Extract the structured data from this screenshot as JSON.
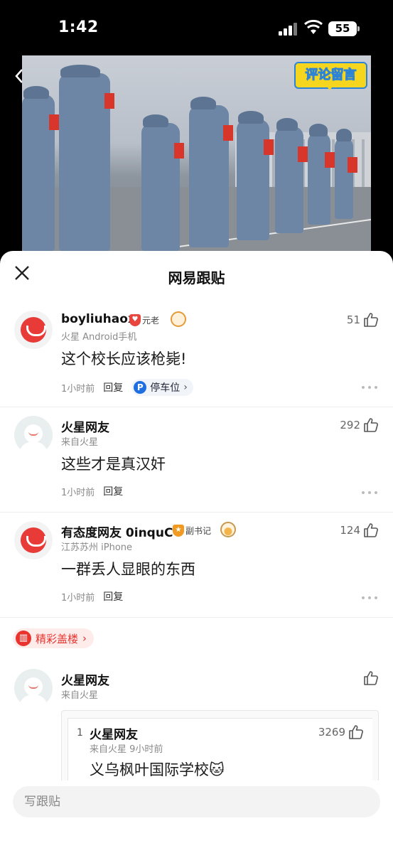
{
  "status_bar": {
    "time": "1:42",
    "battery": "55"
  },
  "video": {
    "badge": "评论留言"
  },
  "sheet": {
    "title": "网易跟贴"
  },
  "comments": [
    {
      "username": "boyliuhaox",
      "badge": "元老",
      "sub": "火星  Android手机",
      "likes": "51",
      "text": "这个校长应该枪毙!",
      "time": "1小时前",
      "reply": "回复",
      "tag": "停车位"
    },
    {
      "username": "火星网友",
      "sub": "来自火星",
      "likes": "292",
      "text": "这些才是真汉奸",
      "time": "1小时前",
      "reply": "回复"
    },
    {
      "username": "有态度网友 0inquC",
      "badge": "副书记",
      "sub": "江苏苏州  iPhone",
      "likes": "124",
      "text": "一群丢人显眼的东西",
      "time": "1小时前",
      "reply": "回复"
    }
  ],
  "hot_section": {
    "label": "精彩盖楼"
  },
  "floor": {
    "username": "火星网友",
    "sub": "来自火星",
    "quote": {
      "index": "1",
      "username": "火星网友",
      "sub": "来自火星  9小时前",
      "likes": "3269",
      "text": "义乌枫叶国际学校🐱"
    }
  },
  "input": {
    "placeholder": "写跟贴"
  }
}
